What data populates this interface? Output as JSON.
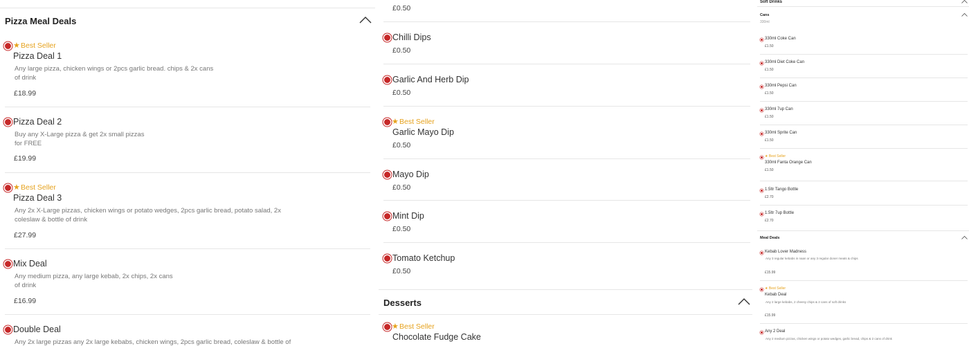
{
  "col1": {
    "section_title": "Pizza Meal Deals",
    "items": [
      {
        "best_seller": "Best Seller",
        "name": "Pizza Deal 1",
        "desc": "Any large pizza, chicken wings or 2pcs garlic bread. chips & 2x cans of drink",
        "price": "£18.99"
      },
      {
        "name": "Pizza Deal 2",
        "desc": "Buy any X-Large pizza & get 2x small pizzas for FREE",
        "price": "£19.99"
      },
      {
        "best_seller": "Best Seller",
        "name": "Pizza Deal 3",
        "desc": "Any 2x X-Large pizzas, chicken wings or potato wedges, 2pcs garlic bread, potato salad, 2x coleslaw & bottle of drink",
        "price": "£27.99"
      },
      {
        "name": "Mix Deal",
        "desc": "Any medium pizza, any large kebab, 2x chips, 2x cans of drink",
        "price": "£16.99"
      },
      {
        "name": "Double Deal",
        "desc": "Any 2x large pizzas any 2x large kebabs, chicken wings, 2pcs garlic bread, coleslaw & bottle of"
      }
    ]
  },
  "col2": {
    "top_price": "£0.50",
    "items": [
      {
        "name": "Chilli Dips",
        "price": "£0.50"
      },
      {
        "name": "Garlic And Herb Dip",
        "price": "£0.50"
      },
      {
        "best_seller": "Best Seller",
        "name": "Garlic Mayo Dip",
        "price": "£0.50"
      },
      {
        "name": "Mayo Dip",
        "price": "£0.50"
      },
      {
        "name": "Mint Dip",
        "price": "£0.50"
      },
      {
        "name": "Tomato Ketchup",
        "price": "£0.50"
      }
    ],
    "desserts_title": "Desserts",
    "dessert": {
      "best_seller": "Best Seller",
      "name": "Chocolate Fudge Cake"
    }
  },
  "col3": {
    "soft_drinks": "Soft Drinks",
    "cans": "Cans",
    "cans_sub": "330ml",
    "drinks": [
      {
        "name": "330ml Coke Can",
        "price": "£1.50"
      },
      {
        "name": "330ml Diet Coke Can",
        "price": "£1.50"
      },
      {
        "name": "330ml Pepsi Can",
        "price": "£1.50"
      },
      {
        "name": "330ml 7up Can",
        "price": "£1.50"
      },
      {
        "name": "330ml Sprite Can",
        "price": "£1.50"
      },
      {
        "best_seller": "Best Seller",
        "name": "330ml Fanta Orange Can",
        "price": "£1.50"
      },
      {
        "name": "1.5ltr Tango Bottle",
        "price": "£2.70"
      },
      {
        "name": "1.5ltr 7up Bottle",
        "price": "£2.70"
      }
    ],
    "meal_deals": "Meal Deals",
    "deals": [
      {
        "name": "Kebab Lover Madness",
        "desc": "Any 3 regular kebabs in naan or any 3 regular doner meats & chips",
        "price": "£15.99"
      },
      {
        "best_seller": "Best Seller",
        "name": "Kebab Deal",
        "desc": "Any 2 large kebabs, 2 cheesy chips & 2 cans of soft drinks",
        "price": "£15.99"
      },
      {
        "name": "Any 2 Deal",
        "desc": "Any 2 medium pizzas, chicken wings or potato wedges, garlic bread, chips & 2 cans of drink"
      }
    ]
  }
}
